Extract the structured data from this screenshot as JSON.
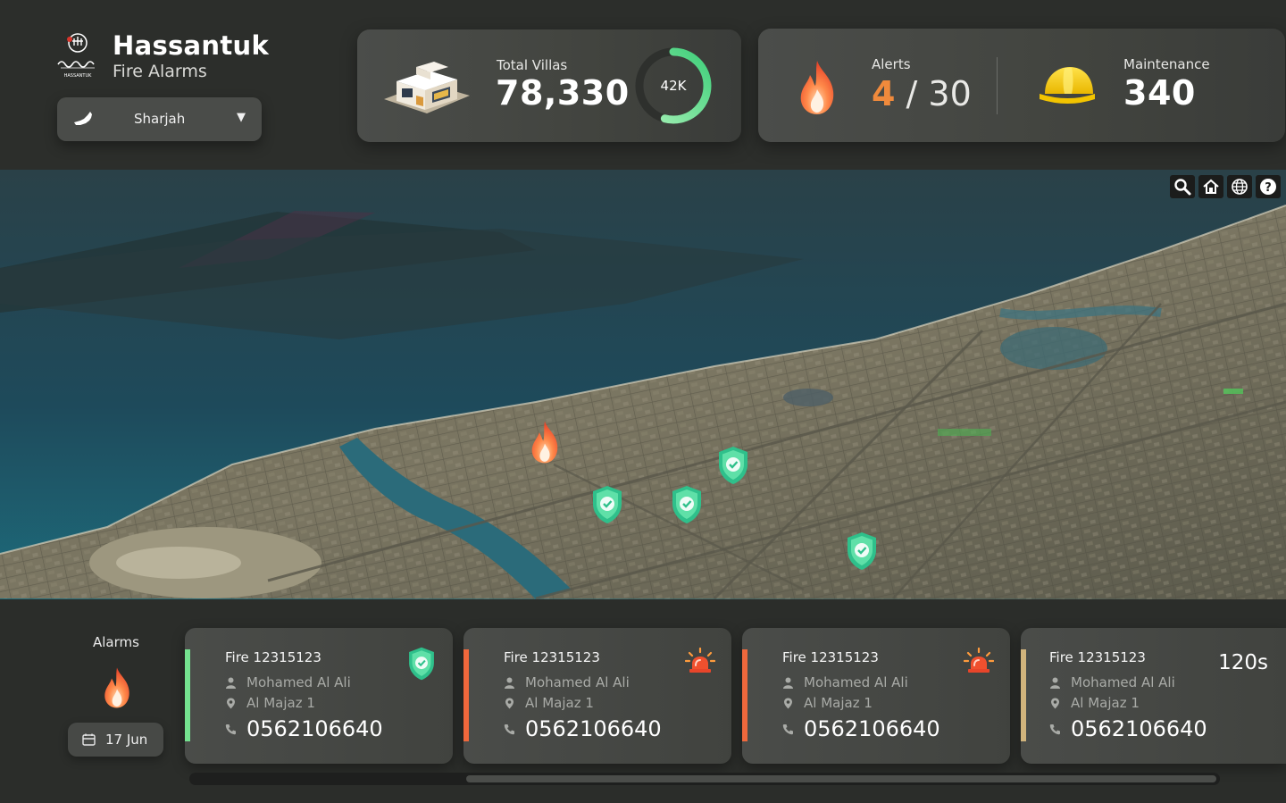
{
  "brand": {
    "title": "Hassantuk",
    "subtitle": "Fire Alarms",
    "logo_text": "حصنتك HASSANTUK"
  },
  "region": {
    "selected": "Sharjah",
    "icon": "uae-map-icon"
  },
  "villas": {
    "label": "Total Villas",
    "value": "78,330",
    "gauge_label": "42K",
    "gauge_fraction": 0.54
  },
  "alerts": {
    "label": "Alerts",
    "current": "4",
    "separator": " / ",
    "total": "30"
  },
  "maintenance": {
    "label": "Maintenance",
    "value": "340"
  },
  "map": {
    "tools": [
      "search-icon",
      "home-icon",
      "globe-icon",
      "help-icon"
    ],
    "markers": [
      "fire-marker",
      "shield-marker",
      "shield-marker",
      "shield-marker",
      "shield-marker"
    ]
  },
  "alarms_panel": {
    "label": "Alarms",
    "date": "17 Jun"
  },
  "alarm_cards": [
    {
      "title": "Fire 12315123",
      "name": "Mohamed Al Ali",
      "location": "Al Majaz 1",
      "phone": "0562106640",
      "status": "secured",
      "accent": "#74e28f"
    },
    {
      "title": "Fire 12315123",
      "name": "Mohamed Al Ali",
      "location": "Al Majaz 1",
      "phone": "0562106640",
      "status": "alarm",
      "accent": "#f0683c"
    },
    {
      "title": "Fire 12315123",
      "name": "Mohamed Al Ali",
      "location": "Al Majaz 1",
      "phone": "0562106640",
      "status": "alarm",
      "accent": "#f0683c"
    },
    {
      "title": "Fire 12315123",
      "name": "Mohamed Al Ali",
      "location": "Al Majaz 1",
      "phone": "0562106640",
      "status": "timer",
      "timer": "120s",
      "accent": "#d1b47c"
    }
  ],
  "colors": {
    "accent_orange": "#f08a3c",
    "gauge_green": "#6fe39a",
    "shield_green": "#2fc08b"
  }
}
